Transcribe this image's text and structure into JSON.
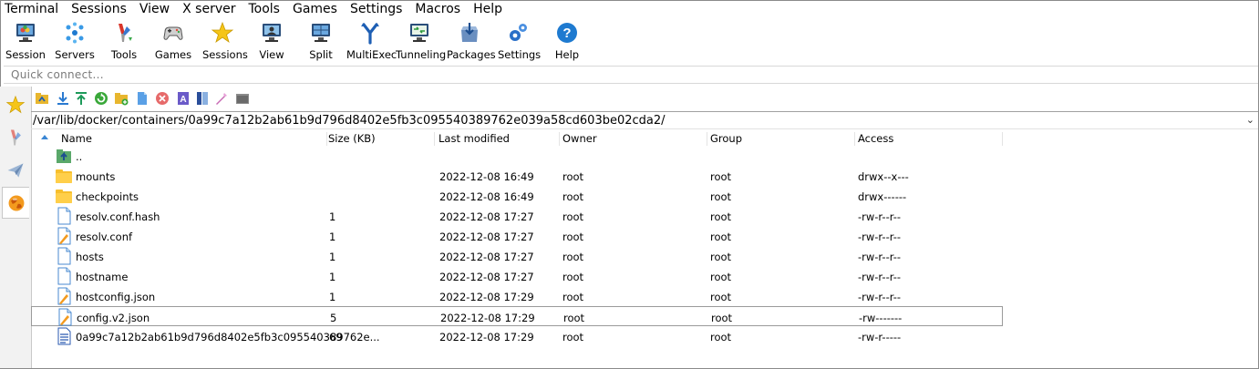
{
  "menu": [
    "Terminal",
    "Sessions",
    "View",
    "X server",
    "Tools",
    "Games",
    "Settings",
    "Macros",
    "Help"
  ],
  "toolbar": [
    {
      "label": "Session",
      "icon": "session-icon"
    },
    {
      "label": "Servers",
      "icon": "servers-icon"
    },
    {
      "label": "Tools",
      "icon": "tools-icon"
    },
    {
      "label": "Games",
      "icon": "games-icon"
    },
    {
      "label": "Sessions",
      "icon": "star-icon"
    },
    {
      "label": "View",
      "icon": "view-icon"
    },
    {
      "label": "Split",
      "icon": "split-icon"
    },
    {
      "label": "MultiExec",
      "icon": "multiexec-icon"
    },
    {
      "label": "Tunneling",
      "icon": "tunneling-icon"
    },
    {
      "label": "Packages",
      "icon": "packages-icon"
    },
    {
      "label": "Settings",
      "icon": "gears-icon"
    },
    {
      "label": "Help",
      "icon": "help-icon"
    }
  ],
  "quick_connect": {
    "placeholder": "Quick connect..."
  },
  "left_tabs": [
    "star-icon",
    "tools-icon",
    "paper-plane-icon",
    "sftp-globe-icon"
  ],
  "sftp_toolbar": [
    "parent-folder-icon",
    "download-icon",
    "upload-icon",
    "refresh-icon",
    "new-folder-icon",
    "new-file-icon",
    "delete-icon",
    "rename-icon",
    "permissions-icon",
    "edit-icon",
    "terminal-icon"
  ],
  "path": "/var/lib/docker/containers/0a99c7a12b2ab61b9d796d8402e5fb3c095540389762e039a58cd603be02cda2/",
  "columns": {
    "name": "Name",
    "size": "Size (KB)",
    "modified": "Last modified",
    "owner": "Owner",
    "group": "Group",
    "access": "Access"
  },
  "files": [
    {
      "name": "..",
      "size": "",
      "modified": "",
      "owner": "",
      "group": "",
      "access": "",
      "type": "up"
    },
    {
      "name": "mounts",
      "size": "",
      "modified": "2022-12-08 16:49",
      "owner": "root",
      "group": "root",
      "access": "drwx--x---",
      "type": "folder"
    },
    {
      "name": "checkpoints",
      "size": "",
      "modified": "2022-12-08 16:49",
      "owner": "root",
      "group": "root",
      "access": "drwx------",
      "type": "folder"
    },
    {
      "name": "resolv.conf.hash",
      "size": "1",
      "modified": "2022-12-08 17:27",
      "owner": "root",
      "group": "root",
      "access": "-rw-r--r--",
      "type": "file"
    },
    {
      "name": "resolv.conf",
      "size": "1",
      "modified": "2022-12-08 17:27",
      "owner": "root",
      "group": "root",
      "access": "-rw-r--r--",
      "type": "edit"
    },
    {
      "name": "hosts",
      "size": "1",
      "modified": "2022-12-08 17:27",
      "owner": "root",
      "group": "root",
      "access": "-rw-r--r--",
      "type": "file"
    },
    {
      "name": "hostname",
      "size": "1",
      "modified": "2022-12-08 17:27",
      "owner": "root",
      "group": "root",
      "access": "-rw-r--r--",
      "type": "file"
    },
    {
      "name": "hostconfig.json",
      "size": "1",
      "modified": "2022-12-08 17:29",
      "owner": "root",
      "group": "root",
      "access": "-rw-r--r--",
      "type": "edit"
    },
    {
      "name": "config.v2.json",
      "size": "5",
      "modified": "2022-12-08 17:29",
      "owner": "root",
      "group": "root",
      "access": "-rw-------",
      "type": "edit",
      "selected": true
    },
    {
      "name": "0a99c7a12b2ab61b9d796d8402e5fb3c095540389762e...",
      "size": "69",
      "modified": "2022-12-08 17:29",
      "owner": "root",
      "group": "root",
      "access": "-rw-r-----",
      "type": "doc"
    }
  ]
}
